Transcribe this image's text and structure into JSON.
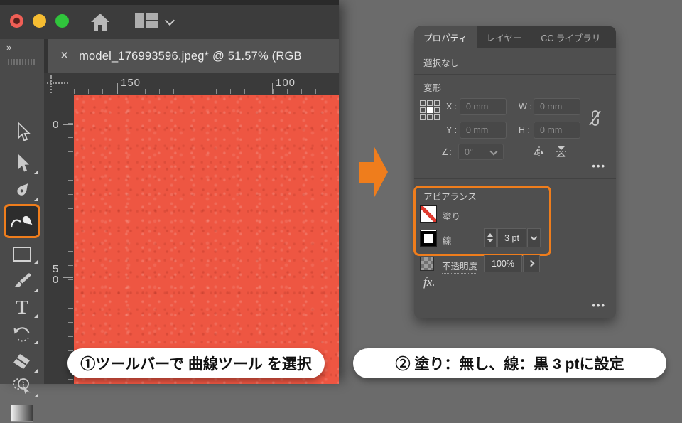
{
  "window": {
    "traffic_lights": [
      "close",
      "minimize",
      "zoom"
    ],
    "toolbar_expand": "»",
    "tab_close": "×",
    "tab_title": "model_176993596.jpeg* @ 51.57% (RGB"
  },
  "rulers": {
    "h_labels": [
      "150",
      "100"
    ],
    "v_labels": [
      "0",
      "50"
    ]
  },
  "toolbar_tools": [
    "selection",
    "direct-selection",
    "pen",
    "curvature-selected",
    "rectangle",
    "paintbrush",
    "type",
    "rotate",
    "eraser",
    "shape-builder",
    "gradient"
  ],
  "panel": {
    "tabs": [
      {
        "label": "プロパティ"
      },
      {
        "label": "レイヤー"
      },
      {
        "label": "CC ライブラリ"
      }
    ],
    "selection_status": "選択なし",
    "transform": {
      "title": "変形",
      "x_label": "X :",
      "x_value": "0 mm",
      "y_label": "Y :",
      "y_value": "0 mm",
      "w_label": "W :",
      "w_value": "0 mm",
      "h_label": "H :",
      "h_value": "0 mm",
      "angle_label": "∠:",
      "angle_value": "0°",
      "more": "•••"
    },
    "appearance": {
      "title": "アピアランス",
      "fill_label": "塗り",
      "stroke_label": "線",
      "stroke_value": "3 pt",
      "opacity_label": "不透明度",
      "opacity_value": "100%",
      "fx_label": "fx.",
      "more": "•••"
    }
  },
  "captions": {
    "step1": "①ツールバーで 曲線ツール を選択",
    "step2": "② 塗り：無し、線：黒 3 ptに設定"
  },
  "colors": {
    "accent_orange": "#EF7D1C",
    "canvas_orange": "#EE5642",
    "panel_bg": "#4F4F4F",
    "chrome_bg": "#3C3C3C",
    "traffic_red": "#F05F56",
    "traffic_yellow": "#F6BD32",
    "traffic_green": "#30C53C"
  }
}
